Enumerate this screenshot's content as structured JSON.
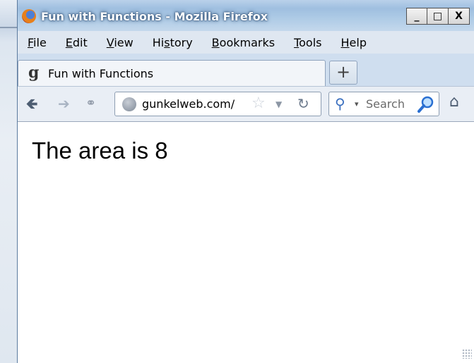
{
  "window": {
    "title": "Fun with Functions - Mozilla Firefox",
    "controls": {
      "minimize": "_",
      "maximize": "□",
      "close": "X"
    }
  },
  "menubar": {
    "items": [
      {
        "label": "File",
        "accel": "F",
        "rest": "ile"
      },
      {
        "label": "Edit",
        "accel": "E",
        "rest": "dit"
      },
      {
        "label": "View",
        "accel": "V",
        "rest": "iew"
      },
      {
        "label": "History",
        "prefix": "Hi",
        "accel": "s",
        "rest": "tory"
      },
      {
        "label": "Bookmarks",
        "accel": "B",
        "rest": "ookmarks"
      },
      {
        "label": "Tools",
        "accel": "T",
        "rest": "ools"
      },
      {
        "label": "Help",
        "accel": "H",
        "rest": "elp"
      }
    ]
  },
  "tabs": [
    {
      "favicon": "g",
      "label": "Fun with Functions"
    }
  ],
  "newtab_label": "+",
  "navbar": {
    "url": "gunkelweb.com/",
    "search_value": "Search"
  },
  "icons": {
    "back": "back-arrow-icon",
    "forward": "forward-arrow-icon",
    "share": "share-icon",
    "globe": "globe-icon",
    "star": "bookmark-star-icon",
    "dropdown": "dropdown-arrow-icon",
    "reload": "reload-icon",
    "search_engine": "search-engine-icon",
    "search_go": "magnifier-icon",
    "home": "home-icon"
  },
  "content": {
    "text": "The area is 8"
  }
}
